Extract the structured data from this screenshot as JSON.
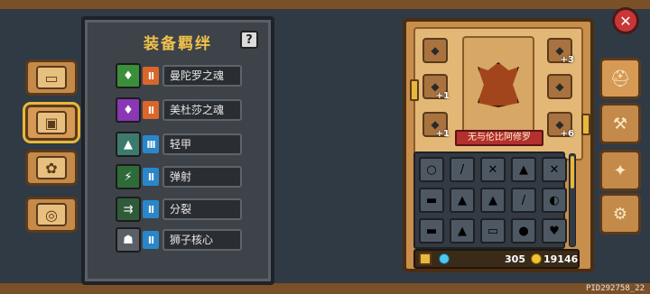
{
  "panel": {
    "title": "装备羁绊",
    "help_label": "?"
  },
  "bonds": [
    {
      "name": "曼陀罗之魂",
      "icon": "green-flame-icon",
      "icon_color": "#3b8f3b",
      "count_color": "#d9662a",
      "count_label": "II"
    },
    {
      "name": "美杜莎之魂",
      "icon": "purple-flame-icon",
      "icon_color": "#8a36b5",
      "count_color": "#d9662a",
      "count_label": "II"
    },
    {
      "name": "轻甲",
      "icon": "light-armor-icon",
      "icon_color": "#3d7a6e",
      "count_color": "#2a86c9",
      "count_label": "III"
    },
    {
      "name": "弹射",
      "icon": "bounce-icon",
      "icon_color": "#2f6b3a",
      "count_color": "#2a86c9",
      "count_label": "II"
    },
    {
      "name": "分裂",
      "icon": "split-icon",
      "icon_color": "#2f5b3a",
      "count_color": "#2a86c9",
      "count_label": "II"
    },
    {
      "name": "狮子核心",
      "icon": "lion-core-icon",
      "icon_color": "#5a6068",
      "count_color": "#2a86c9",
      "count_label": "II"
    }
  ],
  "hero": {
    "name": "无与伦比阿修罗"
  },
  "equip_badges": [
    "+1",
    "+1",
    "+3",
    "+6"
  ],
  "currency": {
    "gems": "305",
    "coins": "19146"
  },
  "pid": "PID292758_22",
  "colors": {
    "accent": "#e8b83a",
    "wood": "#c48a4a",
    "title": "#f0c14a"
  }
}
